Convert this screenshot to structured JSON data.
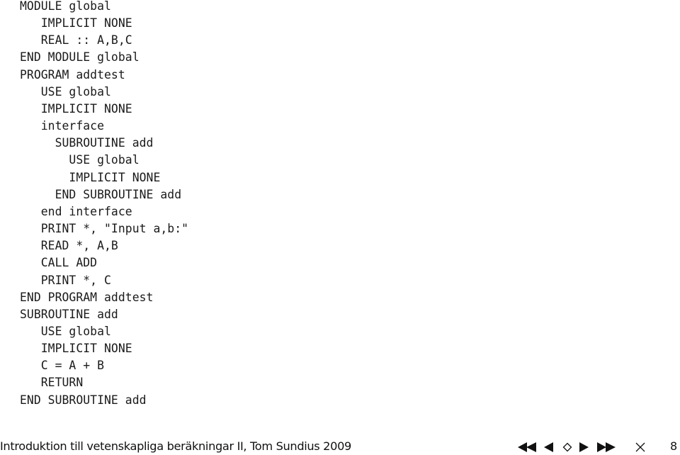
{
  "slide": {
    "code_lines": [
      {
        "indent": 0,
        "text": "MODULE global"
      },
      {
        "indent": 1,
        "text": "IMPLICIT NONE"
      },
      {
        "indent": 1,
        "text": "REAL :: A,B,C"
      },
      {
        "indent": 0,
        "text": "END MODULE global"
      },
      {
        "indent": 0,
        "text": "PROGRAM addtest"
      },
      {
        "indent": 1,
        "text": "USE global"
      },
      {
        "indent": 1,
        "text": "IMPLICIT NONE"
      },
      {
        "indent": 1,
        "text": "interface"
      },
      {
        "indent": 2,
        "text": "SUBROUTINE add"
      },
      {
        "indent": 3,
        "text": "USE global"
      },
      {
        "indent": 3,
        "text": "IMPLICIT NONE"
      },
      {
        "indent": 2,
        "text": "END SUBROUTINE add"
      },
      {
        "indent": 1,
        "text": "end interface"
      },
      {
        "indent": 1,
        "text": "PRINT *, \"Input a,b:\""
      },
      {
        "indent": 1,
        "text": "READ *, A,B"
      },
      {
        "indent": 1,
        "text": "CALL ADD"
      },
      {
        "indent": 1,
        "text": "PRINT *, C"
      },
      {
        "indent": 0,
        "text": "END PROGRAM addtest"
      },
      {
        "indent": 0,
        "text": "SUBROUTINE add"
      },
      {
        "indent": 1,
        "text": "USE global"
      },
      {
        "indent": 1,
        "text": "IMPLICIT NONE"
      },
      {
        "indent": 1,
        "text": "C = A + B"
      },
      {
        "indent": 1,
        "text": "RETURN"
      },
      {
        "indent": 0,
        "text": "END SUBROUTINE add"
      }
    ]
  },
  "footer": {
    "title": "Introduktion till vetenskapliga beräkningar II, Tom Sundius 2009",
    "page_number": "8",
    "nav_icons": [
      {
        "name": "first-page-icon",
        "label": "first"
      },
      {
        "name": "previous-page-icon",
        "label": "previous"
      },
      {
        "name": "back-icon",
        "label": "back"
      },
      {
        "name": "next-page-icon",
        "label": "next"
      },
      {
        "name": "last-page-icon",
        "label": "last"
      },
      {
        "name": "close-icon",
        "label": "close"
      }
    ]
  }
}
